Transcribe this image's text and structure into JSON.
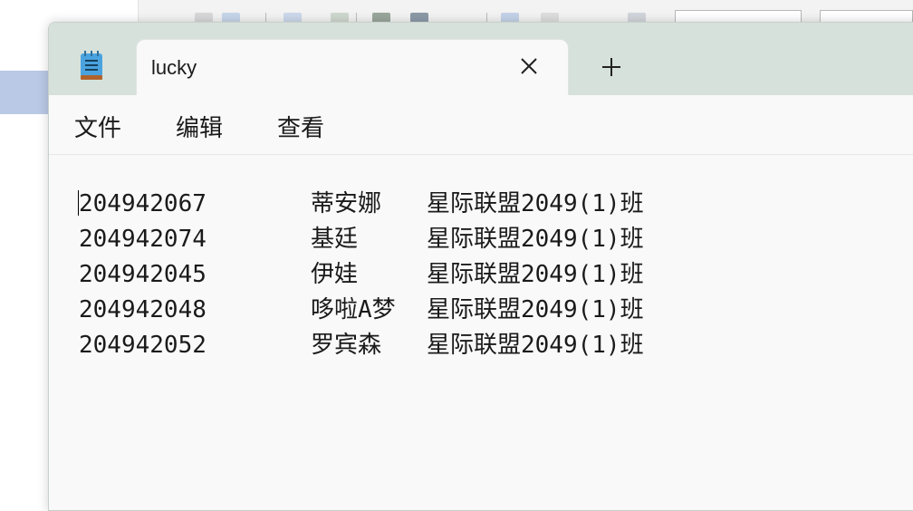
{
  "window": {
    "tab_title": "lucky",
    "icons": {
      "app": "notepad-icon",
      "close": "close-icon",
      "new_tab": "plus-icon"
    }
  },
  "menu": [
    {
      "label": "文件"
    },
    {
      "label": "编辑"
    },
    {
      "label": "查看"
    }
  ],
  "document": {
    "rows": [
      {
        "id": "204942067",
        "name": "蒂安娜",
        "class": "星际联盟2049(1)班"
      },
      {
        "id": "204942074",
        "name": "基廷",
        "class": "星际联盟2049(1)班"
      },
      {
        "id": "204942045",
        "name": "伊娃",
        "class": "星际联盟2049(1)班"
      },
      {
        "id": "204942048",
        "name": "哆啦A梦",
        "class": "星际联盟2049(1)班"
      },
      {
        "id": "204942052",
        "name": "罗宾森",
        "class": "星际联盟2049(1)班"
      }
    ]
  },
  "colors": {
    "titlebar": "#d6e1db",
    "content": "#f9f9f9",
    "text": "#1a1a1a"
  }
}
